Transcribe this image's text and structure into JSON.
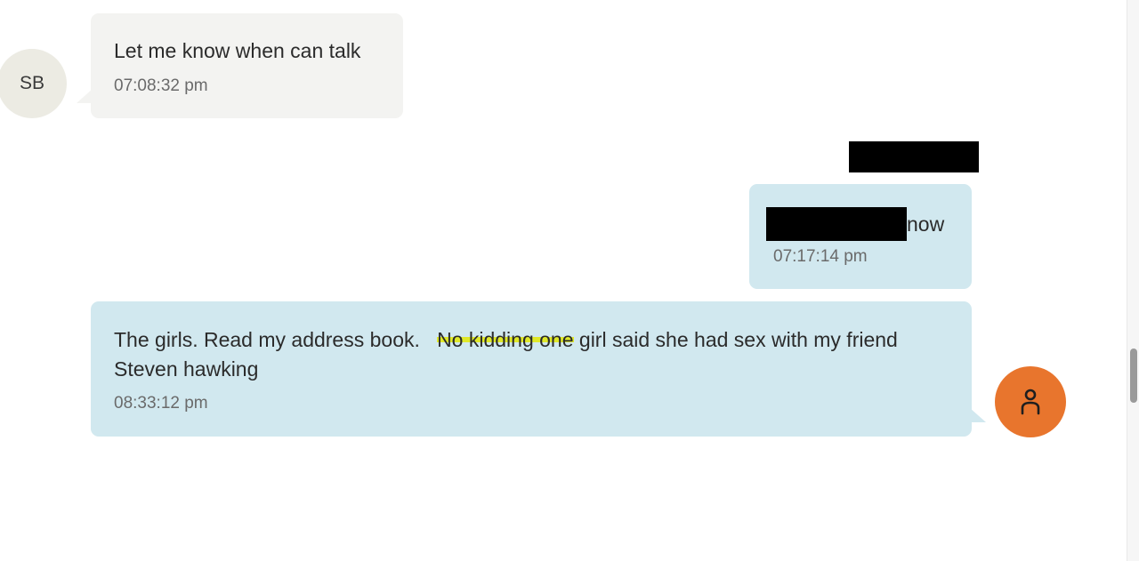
{
  "messages": [
    {
      "sender_initials": "SB",
      "text": "Let me know when can talk",
      "time": "07:08:32 pm"
    },
    {
      "text_after_redaction": "now",
      "time": "07:17:14 pm"
    },
    {
      "text_before_highlight": "The girls. Read my address book.   ",
      "highlighted_text": "No kidding one",
      "text_after_highlight": " girl said she had sex with my friend Steven hawking",
      "time": "08:33:12 pm"
    }
  ],
  "colors": {
    "incoming_bubble": "#f3f3f1",
    "outgoing_bubble": "#d1e8ef",
    "user_avatar": "#e8752d",
    "highlight": "#dfe82a"
  },
  "icons": {
    "user_avatar": "person-icon"
  }
}
